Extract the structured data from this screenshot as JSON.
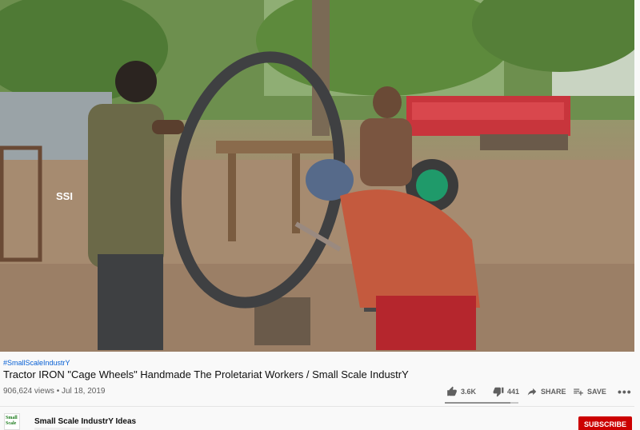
{
  "video": {
    "hashtag": "#SmallScaleIndustrY",
    "title": "Tractor IRON \"Cage Wheels\" Handmade The Proletariat Workers / Small Scale IndustrY",
    "views": "906,624 views",
    "separator": " • ",
    "date": "Jul 18, 2019"
  },
  "actions": {
    "like_count": "3.6K",
    "dislike_count": "441",
    "share_label": "SHARE",
    "save_label": "SAVE",
    "more_label": "•••",
    "like_ratio": 0.89
  },
  "channel": {
    "name": "Small Scale IndustrY Ideas",
    "avatar_text": "Small Scale",
    "subscribe_label": "SUBSCRIBE"
  },
  "video_frame": {
    "watermark": "SSI"
  },
  "colors": {
    "link": "#065fd4",
    "subscribe": "#cc0000",
    "meta": "#606060"
  }
}
